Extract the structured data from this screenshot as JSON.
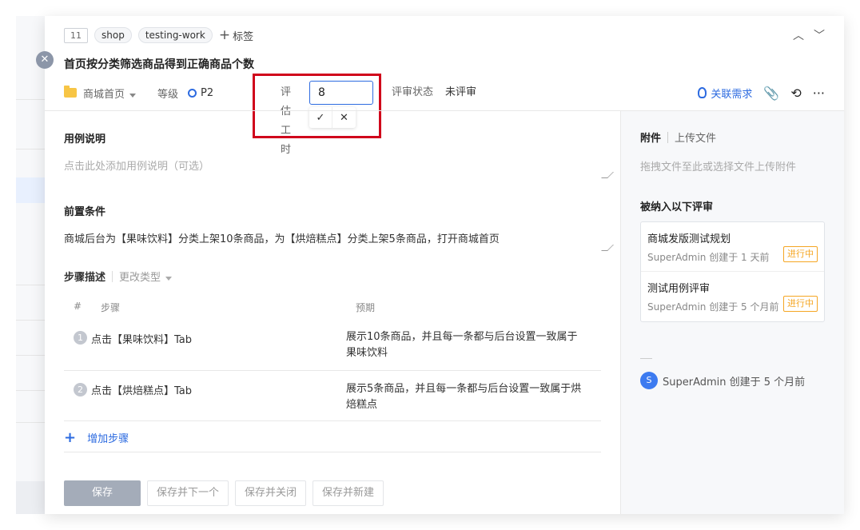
{
  "case": {
    "id": "11",
    "tags": [
      "shop",
      "testing-work"
    ],
    "add_tag_label": "标签",
    "title": "首页按分类筛选商品得到正确商品个数"
  },
  "meta": {
    "module": "商城首页",
    "level_label": "等级",
    "level_value": "P2",
    "estimate_label": "评估工时",
    "estimate_value": "8",
    "review_status_label": "评审状态",
    "review_status_value": "未评审",
    "linked_requirement": "关联需求"
  },
  "sections": {
    "description_title": "用例说明",
    "description_placeholder": "点击此处添加用例说明（可选）",
    "precondition_title": "前置条件",
    "precondition_text": "商城后台为【果味饮料】分类上架10条商品，为【烘焙糕点】分类上架5条商品，打开商城首页",
    "steps_title": "步骤描述",
    "change_type": "更改类型"
  },
  "steps_table": {
    "columns": [
      "#",
      "步骤",
      "预期"
    ],
    "rows": [
      {
        "num": "1",
        "step": "点击【果味饮料】Tab",
        "expected": "展示10条商品，并且每一条都与后台设置一致属于果味饮料"
      },
      {
        "num": "2",
        "step": "点击【烘焙糕点】Tab",
        "expected": "展示5条商品，并且每一条都与后台设置一致属于烘焙糕点"
      }
    ],
    "add_step": "增加步骤"
  },
  "footer": {
    "save": "保存",
    "save_next": "保存并下一个",
    "save_close": "保存并关闭",
    "save_new": "保存并新建"
  },
  "right": {
    "attachments": "附件",
    "upload": "上传文件",
    "drop_hint": "拖拽文件至此或选择文件上传附件",
    "reviews_title": "被纳入以下评审",
    "reviews": [
      {
        "name": "商城发版测试规划",
        "sub": "SuperAdmin 创建于 1 天前",
        "status": "进行中"
      },
      {
        "name": "测试用例评审",
        "sub": "SuperAdmin 创建于 5 个月前",
        "status": "进行中"
      }
    ],
    "avatar_letter": "S",
    "creator": "SuperAdmin 创建于 5 个月前"
  }
}
